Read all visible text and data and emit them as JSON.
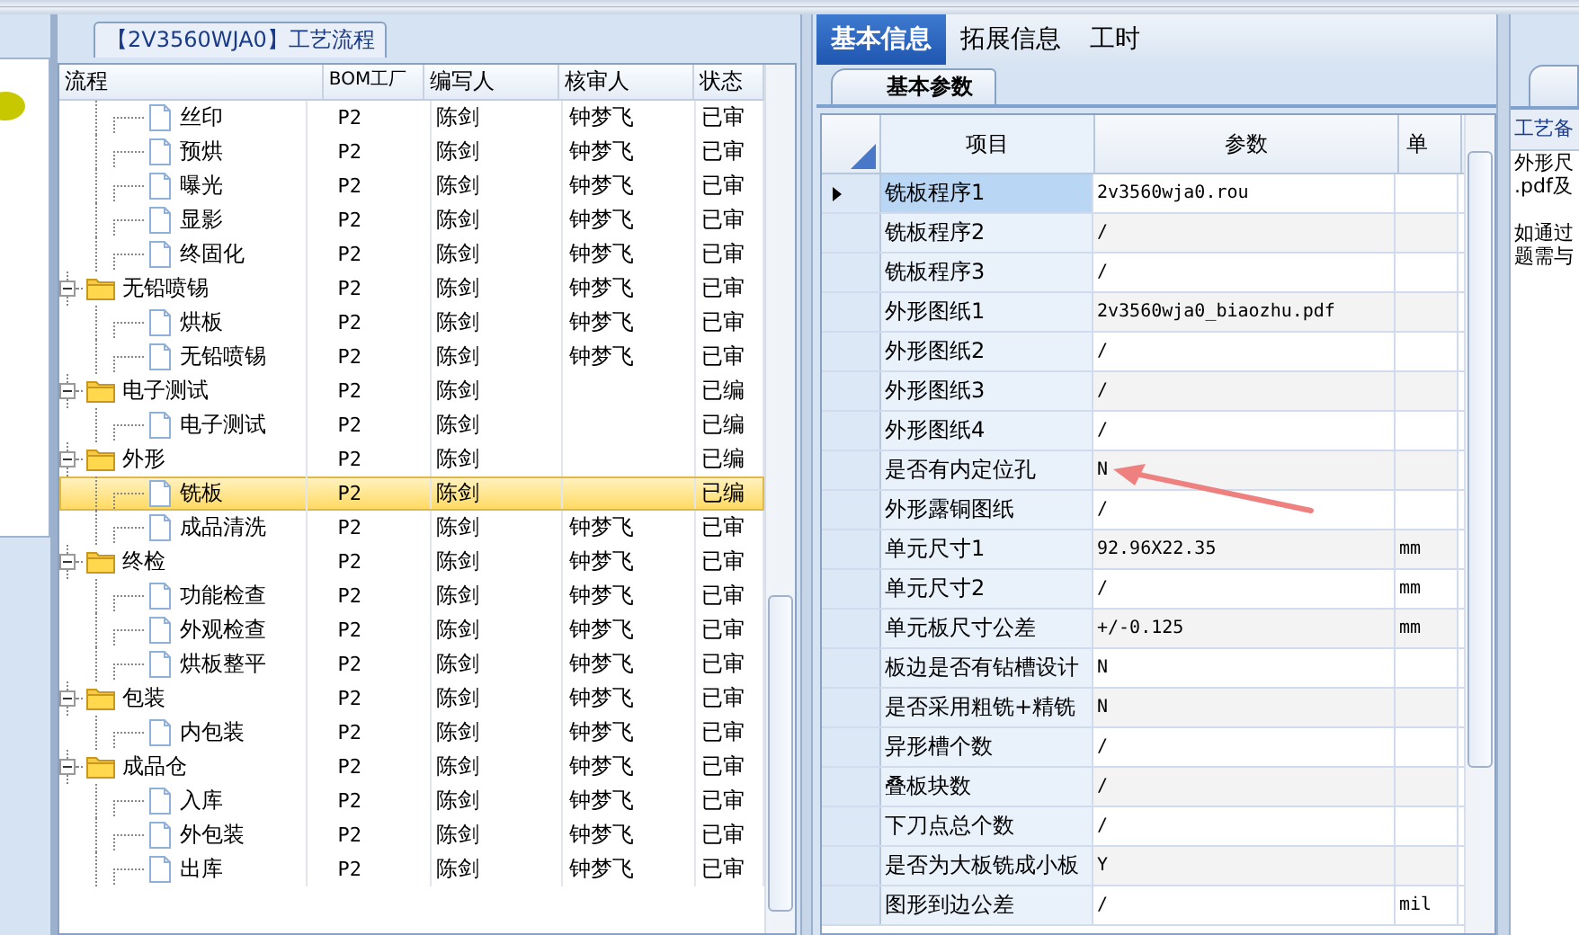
{
  "left_panel": {
    "title": "【2V3560WJA0】工艺流程"
  },
  "process_table": {
    "columns": [
      "流程",
      "BOM工厂",
      "编写人",
      "核审人",
      "状态"
    ],
    "tree": [
      {
        "children": [
          {
            "label": "丝印",
            "kind": "file",
            "selected": false,
            "plant": "P2",
            "author": "陈剑",
            "reviewer": "钟梦飞",
            "status": "已审"
          },
          {
            "label": "预烘",
            "kind": "file",
            "selected": false,
            "plant": "P2",
            "author": "陈剑",
            "reviewer": "钟梦飞",
            "status": "已审"
          },
          {
            "label": "曝光",
            "kind": "file",
            "selected": false,
            "plant": "P2",
            "author": "陈剑",
            "reviewer": "钟梦飞",
            "status": "已审"
          },
          {
            "label": "显影",
            "kind": "file",
            "selected": false,
            "plant": "P2",
            "author": "陈剑",
            "reviewer": "钟梦飞",
            "status": "已审"
          },
          {
            "label": "终固化",
            "kind": "file",
            "selected": false,
            "plant": "P2",
            "author": "陈剑",
            "reviewer": "钟梦飞",
            "status": "已审"
          }
        ]
      },
      {
        "label": "无铅喷锡",
        "kind": "folder",
        "expanded": true,
        "selected": false,
        "plant": "P2",
        "author": "陈剑",
        "reviewer": "钟梦飞",
        "status": "已审",
        "children": [
          {
            "label": "烘板",
            "kind": "file",
            "selected": false,
            "plant": "P2",
            "author": "陈剑",
            "reviewer": "钟梦飞",
            "status": "已审"
          },
          {
            "label": "无铅喷锡",
            "kind": "file",
            "selected": false,
            "plant": "P2",
            "author": "陈剑",
            "reviewer": "钟梦飞",
            "status": "已审"
          }
        ]
      },
      {
        "label": "电子测试",
        "kind": "folder",
        "expanded": true,
        "selected": false,
        "plant": "P2",
        "author": "陈剑",
        "status": "已编",
        "children": [
          {
            "label": "电子测试",
            "kind": "file",
            "selected": false,
            "plant": "P2",
            "author": "陈剑",
            "status": "已编"
          }
        ]
      },
      {
        "label": "外形",
        "kind": "folder",
        "expanded": true,
        "selected": false,
        "plant": "P2",
        "author": "陈剑",
        "status": "已编",
        "children": [
          {
            "label": "铣板",
            "kind": "file",
            "selected": true,
            "plant": "P2",
            "author": "陈剑",
            "status": "已编"
          },
          {
            "label": "成品清洗",
            "kind": "file",
            "selected": false,
            "plant": "P2",
            "author": "陈剑",
            "reviewer": "钟梦飞",
            "status": "已审"
          }
        ]
      },
      {
        "label": "终检",
        "kind": "folder",
        "expanded": true,
        "selected": false,
        "plant": "P2",
        "author": "陈剑",
        "reviewer": "钟梦飞",
        "status": "已审",
        "children": [
          {
            "label": "功能检查",
            "kind": "file",
            "selected": false,
            "plant": "P2",
            "author": "陈剑",
            "reviewer": "钟梦飞",
            "status": "已审"
          },
          {
            "label": "外观检查",
            "kind": "file",
            "selected": false,
            "plant": "P2",
            "author": "陈剑",
            "reviewer": "钟梦飞",
            "status": "已审"
          },
          {
            "label": "烘板整平",
            "kind": "file",
            "selected": false,
            "plant": "P2",
            "author": "陈剑",
            "reviewer": "钟梦飞",
            "status": "已审"
          }
        ]
      },
      {
        "label": "包装",
        "kind": "folder",
        "expanded": true,
        "selected": false,
        "plant": "P2",
        "author": "陈剑",
        "reviewer": "钟梦飞",
        "status": "已审",
        "children": [
          {
            "label": "内包装",
            "kind": "file",
            "selected": false,
            "plant": "P2",
            "author": "陈剑",
            "reviewer": "钟梦飞",
            "status": "已审"
          }
        ]
      },
      {
        "label": "成品仓",
        "kind": "folder",
        "expanded": true,
        "selected": false,
        "plant": "P2",
        "author": "陈剑",
        "reviewer": "钟梦飞",
        "status": "已审",
        "children": [
          {
            "label": "入库",
            "kind": "file",
            "selected": false,
            "plant": "P2",
            "author": "陈剑",
            "reviewer": "钟梦飞",
            "status": "已审"
          },
          {
            "label": "外包装",
            "kind": "file",
            "selected": false,
            "plant": "P2",
            "author": "陈剑",
            "reviewer": "钟梦飞",
            "status": "已审"
          },
          {
            "label": "出库",
            "kind": "file",
            "selected": false,
            "plant": "P2",
            "author": "陈剑",
            "reviewer": "钟梦飞",
            "status": "已审"
          }
        ]
      }
    ]
  },
  "tabs": [
    {
      "label": "基本信息",
      "selected": true
    },
    {
      "label": "拓展信息",
      "selected": false
    },
    {
      "label": "工时",
      "selected": false
    }
  ],
  "sub_tab": {
    "label": "基本参数"
  },
  "param_grid": {
    "columns": [
      "项目",
      "参数",
      "单"
    ],
    "rows": [
      {
        "item": "铣板程序1",
        "value": "2v3560wja0.rou",
        "selected": true
      },
      {
        "item": "铣板程序2",
        "value": "/",
        "selected": false
      },
      {
        "item": "铣板程序3",
        "value": "/",
        "selected": false
      },
      {
        "item": "外形图纸1",
        "value": "2v3560wja0_biaozhu.pdf",
        "selected": false
      },
      {
        "item": "外形图纸2",
        "value": "/",
        "selected": false
      },
      {
        "item": "外形图纸3",
        "value": "/",
        "selected": false
      },
      {
        "item": "外形图纸4",
        "value": "/",
        "selected": false
      },
      {
        "item": "是否有内定位孔",
        "value": "N",
        "selected": false
      },
      {
        "item": "外形露铜图纸",
        "value": "/",
        "selected": false
      },
      {
        "item": "单元尺寸1",
        "value": "92.96X22.35",
        "unit": "mm",
        "selected": false
      },
      {
        "item": "单元尺寸2",
        "value": "/",
        "unit": "mm",
        "selected": false
      },
      {
        "item": "单元板尺寸公差",
        "value": "+/-0.125",
        "unit": "mm",
        "selected": false
      },
      {
        "item": "板边是否有钻槽设计",
        "value": "N",
        "selected": false
      },
      {
        "item": "是否采用粗铣+精铣",
        "value": "N",
        "selected": false
      },
      {
        "item": "异形槽个数",
        "value": "/",
        "selected": false
      },
      {
        "item": "叠板块数",
        "value": "/",
        "selected": false
      },
      {
        "item": "下刀点总个数",
        "value": "/",
        "selected": false
      },
      {
        "item": "是否为大板铣成小板",
        "value": "Y",
        "selected": false
      },
      {
        "item": "图形到边公差",
        "value": "/",
        "unit": "mil",
        "selected": false
      }
    ]
  },
  "side_panel": {
    "header": "工艺备",
    "paragraphs": [
      [
        "外形尺",
        ".pdf及"
      ],
      [
        "如通过",
        "题需与"
      ]
    ]
  }
}
